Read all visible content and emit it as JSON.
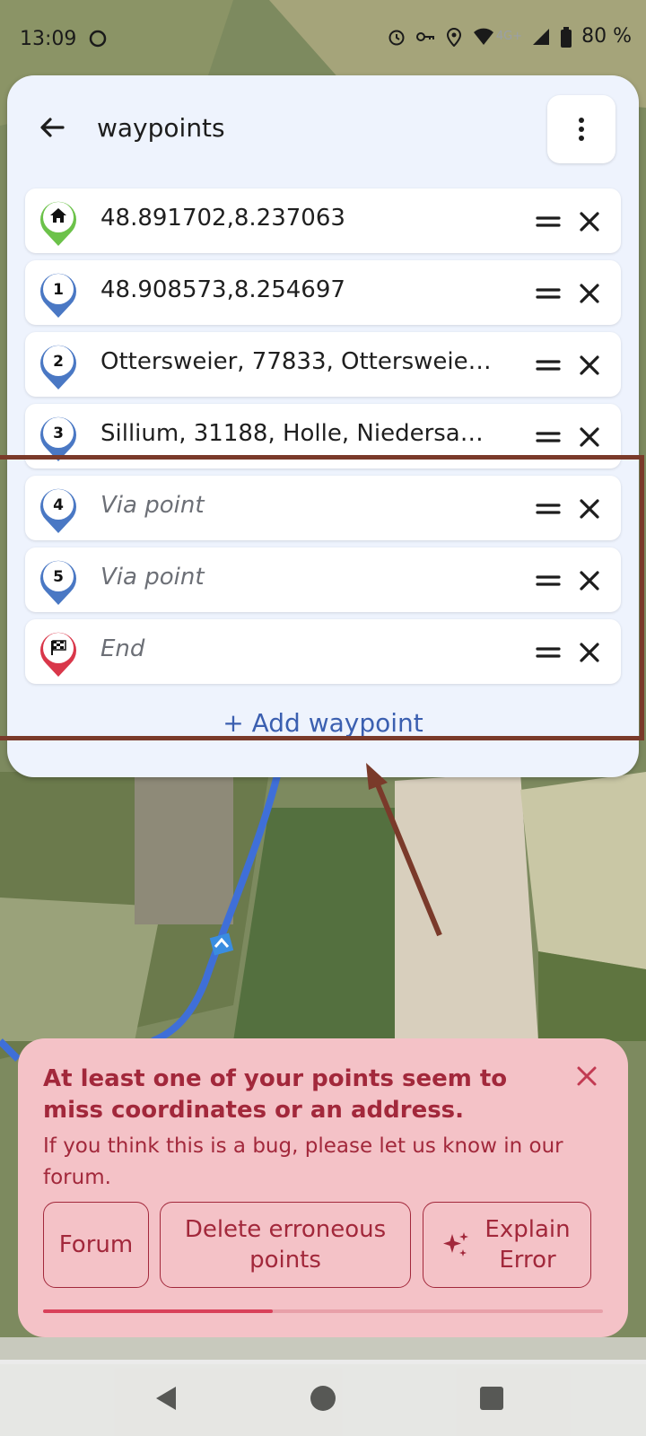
{
  "status_bar": {
    "time": "13:09",
    "network": "4G+",
    "battery": "80 %"
  },
  "waypoints_panel": {
    "title": "waypoints",
    "back_icon": "arrow-left-icon",
    "menu_icon": "more-vert-icon",
    "items": [
      {
        "badge": "home",
        "pin_color": "#6cc24a",
        "text": "48.891702,8.237063",
        "is_placeholder": false
      },
      {
        "badge": "1",
        "pin_color": "#4a78c4",
        "text": "48.908573,8.254697",
        "is_placeholder": false
      },
      {
        "badge": "2",
        "pin_color": "#4a78c4",
        "text": "Ottersweier, 77833, Ottersweier, …",
        "is_placeholder": false
      },
      {
        "badge": "3",
        "pin_color": "#4a78c4",
        "text": "Sillium, 31188, Holle, Niedersachs…",
        "is_placeholder": false
      },
      {
        "badge": "4",
        "pin_color": "#4a78c4",
        "text": "Via point",
        "is_placeholder": true
      },
      {
        "badge": "5",
        "pin_color": "#4a78c4",
        "text": "Via point",
        "is_placeholder": true
      },
      {
        "badge": "flag",
        "pin_color": "#d9374a",
        "text": "End",
        "is_placeholder": true
      }
    ],
    "add_waypoint_label": "+ Add waypoint"
  },
  "error_panel": {
    "title": "At least one of your points seem to miss coordinates or an address.",
    "message": "If you think this is a bug, please let us know in our forum.",
    "buttons": {
      "forum": "Forum",
      "delete": "Delete erroneous points",
      "explain": "Explain Error"
    },
    "progress": 0.41,
    "color": "#a2283b"
  }
}
